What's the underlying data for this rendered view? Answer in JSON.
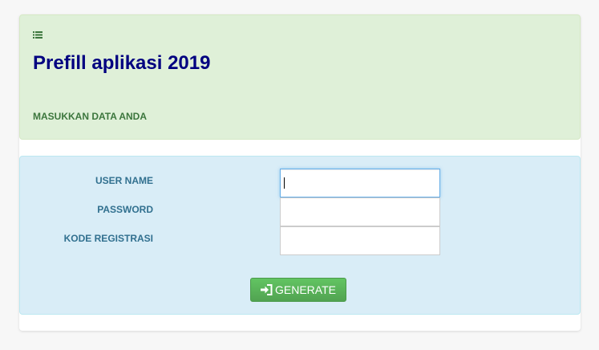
{
  "header": {
    "icon": "list-icon",
    "title": "Prefill aplikasi 2019",
    "subtitle": "MASUKKAN DATA ANDA"
  },
  "form": {
    "fields": [
      {
        "label": "USER NAME",
        "value": "",
        "focused": true
      },
      {
        "label": "PASSWORD",
        "value": ""
      },
      {
        "label": "KODE REGISTRASI",
        "value": ""
      }
    ],
    "button": {
      "label": "GENERATE",
      "icon": "sign-in-icon"
    }
  },
  "colors": {
    "header_bg": "#dff0d8",
    "title": "#000080",
    "subtitle": "#3c763d",
    "form_bg": "#d9edf7",
    "label": "#31708f",
    "button": "#5cb85c"
  }
}
